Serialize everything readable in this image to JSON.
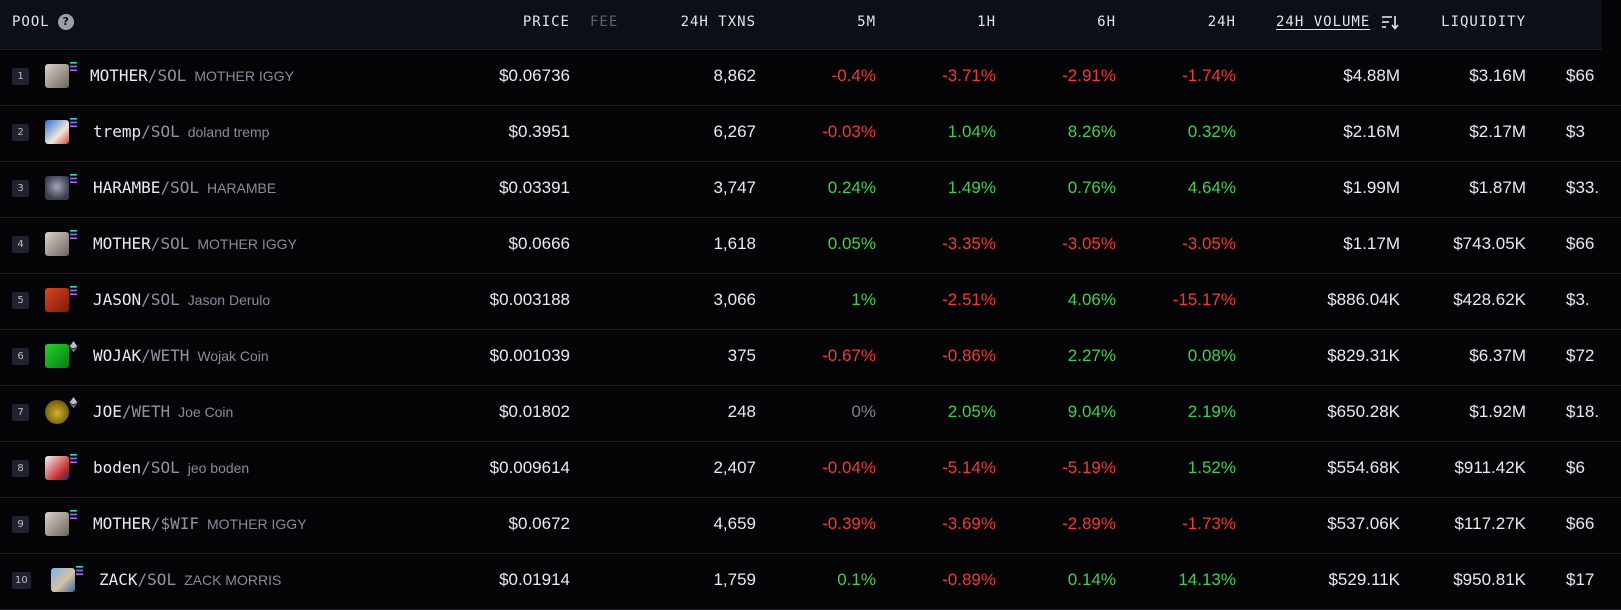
{
  "header": {
    "pool": "POOL",
    "help": "?",
    "price": "PRICE",
    "fee": "FEE",
    "txns": "24H TXNS",
    "m5": "5M",
    "h1": "1H",
    "h6": "6H",
    "h24": "24H",
    "volume": "24H VOLUME",
    "liquidity": "LIQUIDITY",
    "sort_icon": "sort-desc-icon"
  },
  "colors": {
    "positive": "#3fcf55",
    "negative": "#ee3b3b",
    "neutral": "#7c8190"
  },
  "rows": [
    {
      "rank": "1",
      "base": "MOTHER",
      "sep": "/",
      "quote": "SOL",
      "chain": "solana",
      "name": "MOTHER IGGY",
      "price": "$0.06736",
      "txns": "8,862",
      "m5": "-0.4%",
      "h1": "-3.71%",
      "h6": "-2.91%",
      "h24": "-1.74%",
      "volume": "$4.88M",
      "liquidity": "$3.16M",
      "fdv": "$66"
    },
    {
      "rank": "2",
      "base": "tremp",
      "sep": "/",
      "quote": "SOL",
      "chain": "solana",
      "name": "doland tremp",
      "price": "$0.3951",
      "txns": "6,267",
      "m5": "-0.03%",
      "h1": "1.04%",
      "h6": "8.26%",
      "h24": "0.32%",
      "volume": "$2.16M",
      "liquidity": "$2.17M",
      "fdv": "$3"
    },
    {
      "rank": "3",
      "base": "HARAMBE",
      "sep": "/",
      "quote": "SOL",
      "chain": "solana",
      "name": "HARAMBE",
      "price": "$0.03391",
      "txns": "3,747",
      "m5": "0.24%",
      "h1": "1.49%",
      "h6": "0.76%",
      "h24": "4.64%",
      "volume": "$1.99M",
      "liquidity": "$1.87M",
      "fdv": "$33."
    },
    {
      "rank": "4",
      "base": "MOTHER",
      "sep": "/",
      "quote": "SOL",
      "chain": "solana",
      "name": "MOTHER IGGY",
      "price": "$0.0666",
      "txns": "1,618",
      "m5": "0.05%",
      "h1": "-3.35%",
      "h6": "-3.05%",
      "h24": "-3.05%",
      "volume": "$1.17M",
      "liquidity": "$743.05K",
      "fdv": "$66"
    },
    {
      "rank": "5",
      "base": "JASON",
      "sep": "/",
      "quote": "SOL",
      "chain": "solana",
      "name": "Jason Derulo",
      "price": "$0.003188",
      "txns": "3,066",
      "m5": "1%",
      "h1": "-2.51%",
      "h6": "4.06%",
      "h24": "-15.17%",
      "volume": "$886.04K",
      "liquidity": "$428.62K",
      "fdv": "$3."
    },
    {
      "rank": "6",
      "base": "WOJAK",
      "sep": "/",
      "quote": "WETH",
      "chain": "ethereum",
      "name": "Wojak Coin",
      "price": "$0.001039",
      "txns": "375",
      "m5": "-0.67%",
      "h1": "-0.86%",
      "h6": "2.27%",
      "h24": "0.08%",
      "volume": "$829.31K",
      "liquidity": "$6.37M",
      "fdv": "$72"
    },
    {
      "rank": "7",
      "base": "JOE",
      "sep": "/",
      "quote": "WETH",
      "chain": "ethereum",
      "name": "Joe Coin",
      "price": "$0.01802",
      "txns": "248",
      "m5": "0%",
      "h1": "2.05%",
      "h6": "9.04%",
      "h24": "2.19%",
      "volume": "$650.28K",
      "liquidity": "$1.92M",
      "fdv": "$18."
    },
    {
      "rank": "8",
      "base": "boden",
      "sep": "/",
      "quote": "SOL",
      "chain": "solana",
      "name": "jeo boden",
      "price": "$0.009614",
      "txns": "2,407",
      "m5": "-0.04%",
      "h1": "-5.14%",
      "h6": "-5.19%",
      "h24": "1.52%",
      "volume": "$554.68K",
      "liquidity": "$911.42K",
      "fdv": "$6"
    },
    {
      "rank": "9",
      "base": "MOTHER",
      "sep": "/",
      "quote": "$WIF",
      "chain": "solana",
      "name": "MOTHER IGGY",
      "price": "$0.0672",
      "txns": "4,659",
      "m5": "-0.39%",
      "h1": "-3.69%",
      "h6": "-2.89%",
      "h24": "-1.73%",
      "volume": "$537.06K",
      "liquidity": "$117.27K",
      "fdv": "$66"
    },
    {
      "rank": "10",
      "base": "ZACK",
      "sep": "/",
      "quote": "SOL",
      "chain": "solana",
      "name": "ZACK MORRIS",
      "price": "$0.01914",
      "txns": "1,759",
      "m5": "0.1%",
      "h1": "-0.89%",
      "h6": "0.14%",
      "h24": "14.13%",
      "volume": "$529.11K",
      "liquidity": "$950.81K",
      "fdv": "$17"
    }
  ]
}
